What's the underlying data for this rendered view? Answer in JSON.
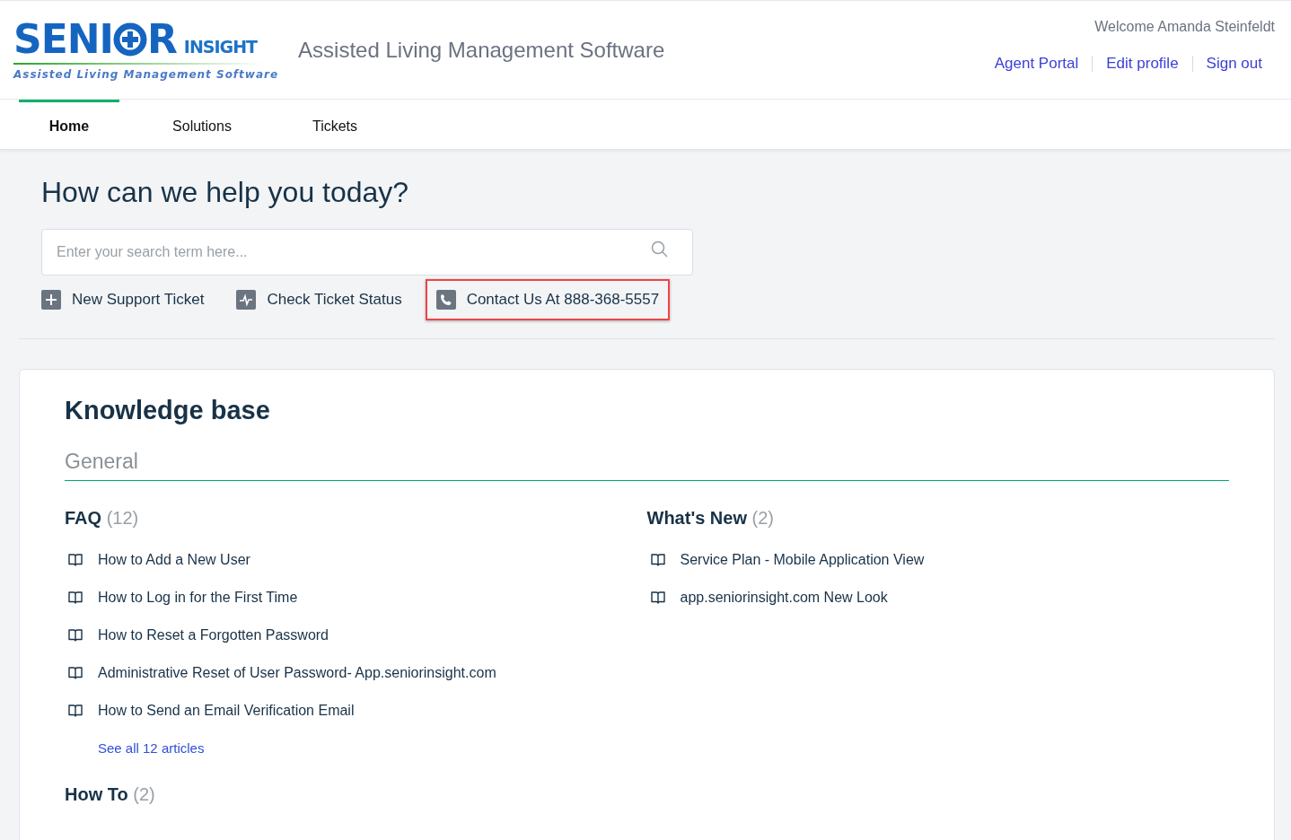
{
  "logo": {
    "word_start": "SENI",
    "word_end": "R",
    "suffix": "INSIGHT",
    "tagline": "Assisted Living Management Software"
  },
  "header_title": "Assisted Living Management Software",
  "welcome": "Welcome Amanda Steinfeldt",
  "user_links": [
    "Agent Portal",
    "Edit profile",
    "Sign out"
  ],
  "tabs": [
    {
      "label": "Home",
      "selected": true
    },
    {
      "label": "Solutions",
      "selected": false
    },
    {
      "label": "Tickets",
      "selected": false
    }
  ],
  "hero": {
    "title": "How can we help you today?",
    "search": {
      "placeholder": "Enter your search term here..."
    },
    "actions": [
      {
        "kind": "plus",
        "label": "New Support Ticket",
        "highlighted": false
      },
      {
        "kind": "pulse",
        "label": "Check Ticket Status",
        "highlighted": false
      },
      {
        "kind": "phone",
        "label": "Contact Us At 888-368-5557",
        "highlighted": true
      }
    ]
  },
  "knowledge_base": {
    "title": "Knowledge base",
    "category": "General",
    "folders": [
      {
        "title": "FAQ",
        "count": "(12)",
        "articles": [
          "How to Add a New User",
          "How to Log in for the First Time",
          "How to Reset a Forgotten Password",
          "Administrative Reset of User Password- App.seniorinsight.com",
          "How to Send an Email Verification Email"
        ],
        "see_all": "See all 12 articles"
      },
      {
        "title": "What's New",
        "count": "(2)",
        "articles": [
          "Service Plan - Mobile Application View",
          "app.seniorinsight.com New Look"
        ]
      },
      {
        "title": "How To",
        "count": "(2)"
      }
    ]
  }
}
